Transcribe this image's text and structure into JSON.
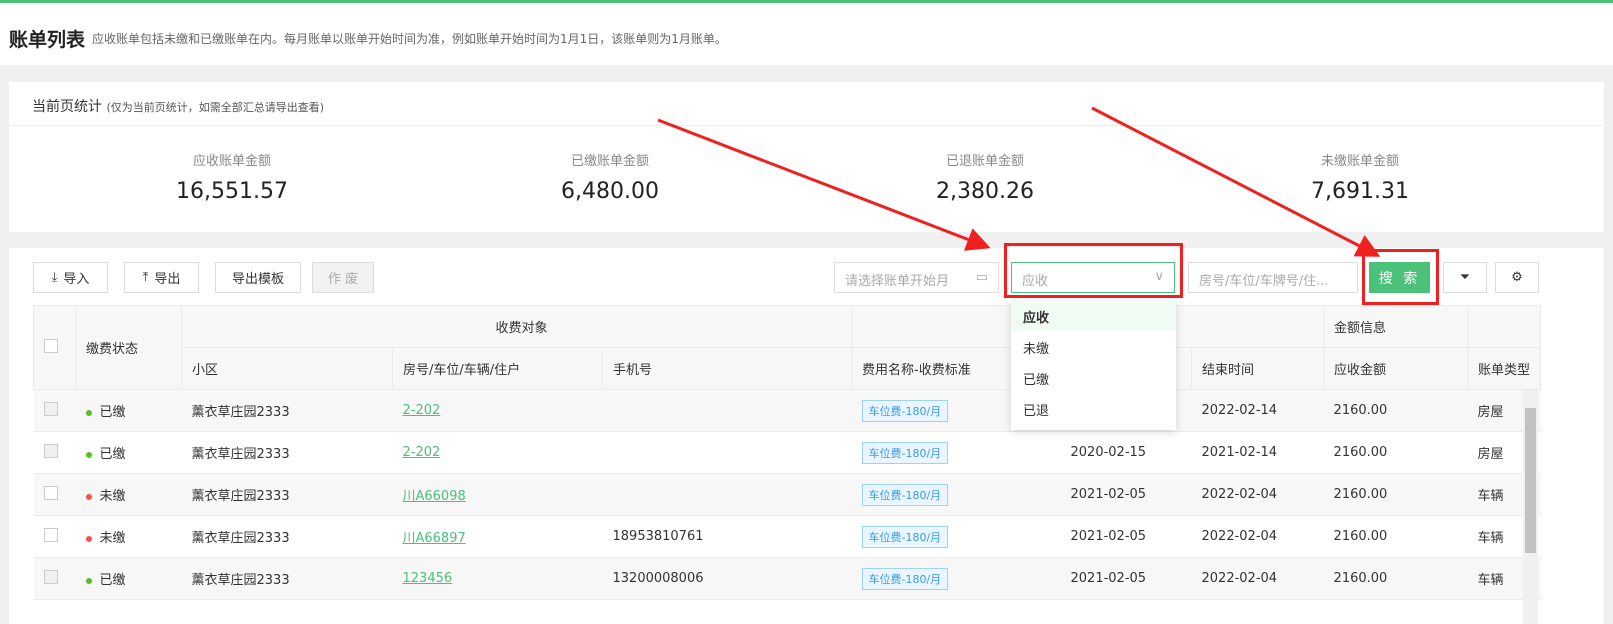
{
  "header": {
    "title": "账单列表",
    "desc": "应收账单包括未缴和已缴账单在内。每月账单以账单开始时间为准，例如账单开始时间为1月1日，该账单则为1月账单。"
  },
  "stats": {
    "title": "当前页统计",
    "note": "(仅为当前页统计，如需全部汇总请导出查看)",
    "items": [
      {
        "label": "应收账单金额",
        "value": "16,551.57"
      },
      {
        "label": "已缴账单金额",
        "value": "6,480.00"
      },
      {
        "label": "已退账单金额",
        "value": "2,380.26"
      },
      {
        "label": "未缴账单金额",
        "value": "7,691.31"
      }
    ]
  },
  "toolbar": {
    "import": "导入",
    "export": "导出",
    "export_template": "导出模板",
    "void": "作 废",
    "month_placeholder": "请选择账单开始月",
    "type_value": "应收",
    "keyword_placeholder": "房号/车位/车牌号/住...",
    "search": "搜 索"
  },
  "dropdown": {
    "options": [
      "应收",
      "未缴",
      "已缴",
      "已退"
    ],
    "selected": "应收"
  },
  "table": {
    "group_headers": {
      "target": "收费对象",
      "amount": "金额信息"
    },
    "headers": {
      "status": "缴费状态",
      "community": "小区",
      "room": "房号/车位/车辆/住户",
      "phone": "手机号",
      "fee": "费用名称-收费标准",
      "end": "结束时间",
      "amount": "应收金额",
      "type": "账单类型"
    },
    "rows": [
      {
        "status": "已缴",
        "community": "薰衣草庄园2333",
        "room": "2-202",
        "phone": "",
        "fee": "车位费-180/月",
        "start": "",
        "end": "2022-02-14",
        "amount": "2160.00",
        "type": "房屋"
      },
      {
        "status": "已缴",
        "community": "薰衣草庄园2333",
        "room": "2-202",
        "phone": "",
        "fee": "车位费-180/月",
        "start": "2020-02-15",
        "end": "2021-02-14",
        "amount": "2160.00",
        "type": "房屋"
      },
      {
        "status": "未缴",
        "community": "薰衣草庄园2333",
        "room": "川A66098",
        "phone": "",
        "fee": "车位费-180/月",
        "start": "2021-02-05",
        "end": "2022-02-04",
        "amount": "2160.00",
        "type": "车辆"
      },
      {
        "status": "未缴",
        "community": "薰衣草庄园2333",
        "room": "川A66897",
        "phone": "18953810761",
        "fee": "车位费-180/月",
        "start": "2021-02-05",
        "end": "2022-02-04",
        "amount": "2160.00",
        "type": "车辆"
      },
      {
        "status": "已缴",
        "community": "薰衣草庄园2333",
        "room": "123456",
        "phone": "13200008006",
        "fee": "车位费-180/月",
        "start": "2021-02-05",
        "end": "2022-02-04",
        "amount": "2160.00",
        "type": "车辆"
      }
    ]
  },
  "colors": {
    "accent": "#4cc17a",
    "paid": "#52c41a",
    "unpaid": "#f5504f",
    "annotation": "#f02020"
  }
}
